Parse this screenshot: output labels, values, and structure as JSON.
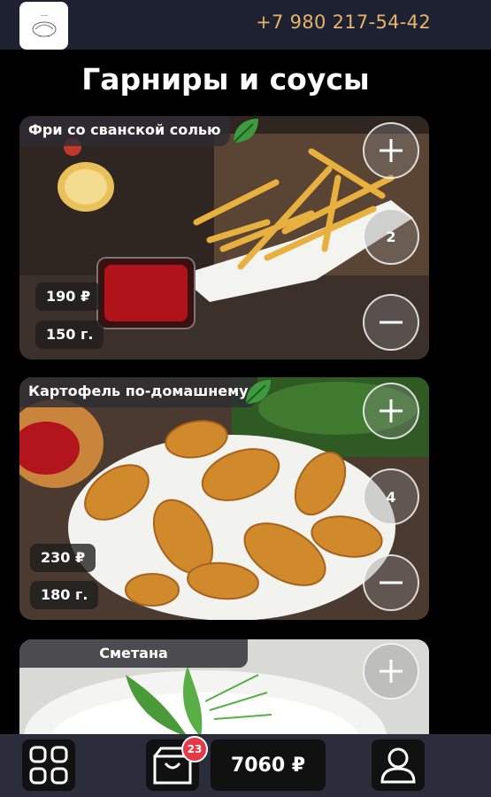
{
  "header": {
    "phone": "+7 980 217-54-42",
    "logo_icon": "restaurant-logo-icon"
  },
  "page_title": "Гарниры и соусы",
  "products": [
    {
      "name": "Фри со сванской солью",
      "price": "190 ₽",
      "weight": "150 г.",
      "quantity": "2"
    },
    {
      "name": "Картофель по-домашнему",
      "price": "230 ₽",
      "weight": "180 г.",
      "quantity": "4"
    },
    {
      "name": "Сметана"
    }
  ],
  "cart": {
    "count": "23",
    "total": "7060 ₽"
  },
  "colors": {
    "phone": "#e5b46a",
    "badge": "#e63946",
    "leaf": "#3f9a3f"
  }
}
